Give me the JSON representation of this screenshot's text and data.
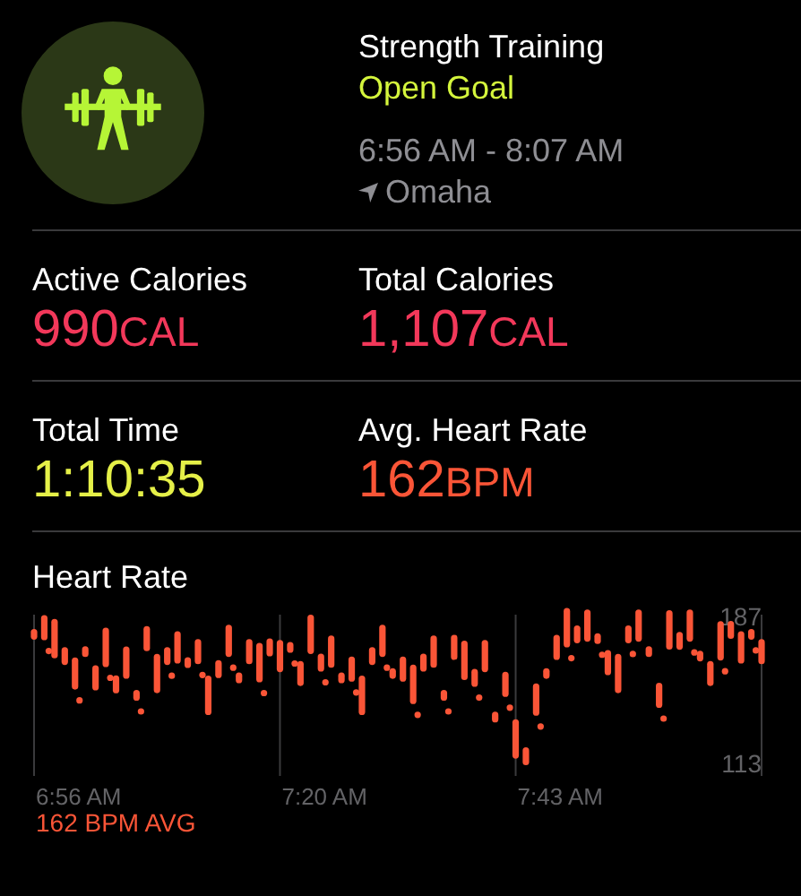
{
  "workout": {
    "title": "Strength Training",
    "goal": "Open Goal",
    "time_range": "6:56 AM - 8:07 AM",
    "location": "Omaha"
  },
  "stats": [
    {
      "label": "Active Calories",
      "value": "990",
      "unit": "CAL",
      "color": "#f2385a"
    },
    {
      "label": "Total Calories",
      "value": "1,107",
      "unit": "CAL",
      "color": "#f2385a"
    },
    {
      "label": "Total Time",
      "value": "1:10:35",
      "color": "#e5f048"
    },
    {
      "label": "Avg. Heart Rate",
      "value": "162",
      "unit": "BPM",
      "color": "#fa5537"
    }
  ],
  "heart_rate": {
    "title": "Heart Rate",
    "max_label": "187",
    "min_label": "113",
    "time_labels": [
      "6:56 AM",
      "7:20 AM",
      "7:43 AM"
    ],
    "average": "162 BPM AVG"
  }
}
